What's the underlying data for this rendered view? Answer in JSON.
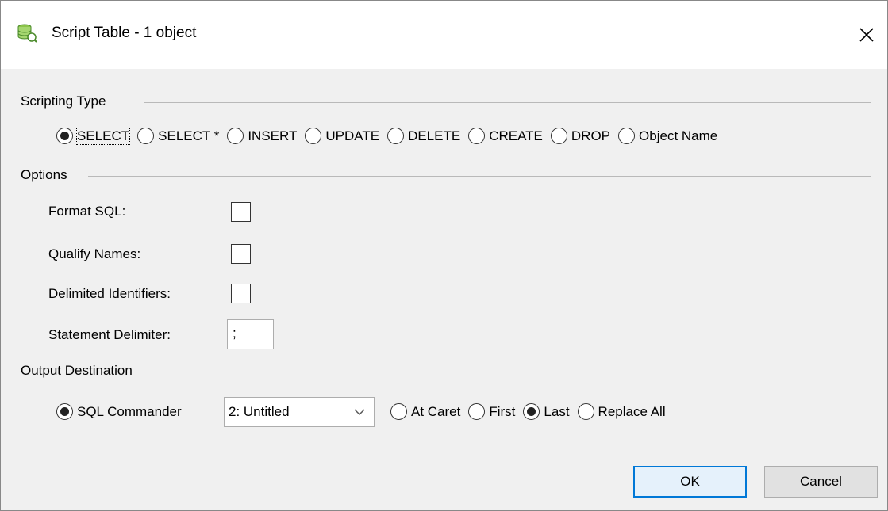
{
  "window": {
    "title": "Script Table - 1 object",
    "close_glyph": "✕",
    "icon": "database-table-icon"
  },
  "scripting_type": {
    "label": "Scripting Type",
    "options": [
      "SELECT",
      "SELECT *",
      "INSERT",
      "UPDATE",
      "DELETE",
      "CREATE",
      "DROP",
      "Object Name"
    ],
    "selected": "SELECT"
  },
  "options": {
    "label": "Options",
    "format_sql": {
      "label": "Format SQL:",
      "checked": false
    },
    "qualify_names": {
      "label": "Qualify Names:",
      "checked": false
    },
    "delimited_identifiers": {
      "label": "Delimited Identifiers:",
      "checked": false
    },
    "statement_delimiter": {
      "label": "Statement Delimiter:",
      "value": ";"
    }
  },
  "output": {
    "label": "Output Destination",
    "sql_commander_label": "SQL Commander",
    "commander_selected": "2: Untitled",
    "position_options": [
      "At Caret",
      "First",
      "Last",
      "Replace All"
    ],
    "position_selected": "Last"
  },
  "buttons": {
    "ok": "OK",
    "cancel": "Cancel"
  },
  "colors": {
    "accent": "#0078d7",
    "icon_green": "#4caf50"
  }
}
